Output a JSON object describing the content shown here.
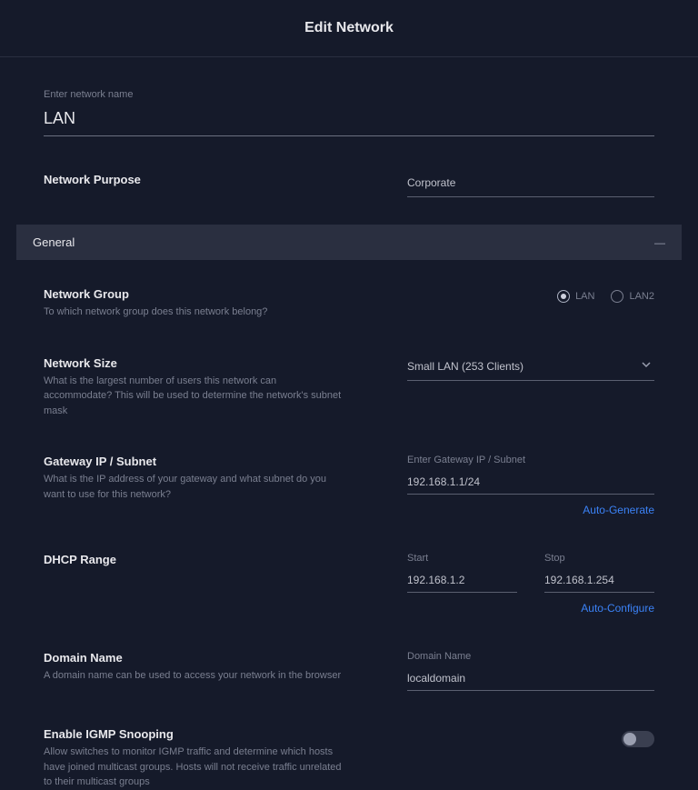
{
  "header": {
    "title": "Edit Network"
  },
  "name_section": {
    "label": "Enter network name",
    "value": "LAN"
  },
  "purpose": {
    "title": "Network Purpose",
    "value": "Corporate"
  },
  "general_section": {
    "title": "General"
  },
  "network_group": {
    "title": "Network Group",
    "desc": "To which network group does this network belong?",
    "options": {
      "lan": "LAN",
      "lan2": "LAN2"
    },
    "selected": "lan"
  },
  "network_size": {
    "title": "Network Size",
    "desc": "What is the largest number of users this network can accommodate? This will be used to determine the network's subnet mask",
    "value": "Small LAN (253 Clients)"
  },
  "gateway": {
    "title": "Gateway IP / Subnet",
    "desc": "What is the IP address of your gateway and what subnet do you want to use for this network?",
    "input_label": "Enter Gateway IP / Subnet",
    "value": "192.168.1.1/24",
    "action": "Auto-Generate"
  },
  "dhcp": {
    "title": "DHCP Range",
    "start_label": "Start",
    "start_value": "192.168.1.2",
    "stop_label": "Stop",
    "stop_value": "192.168.1.254",
    "action": "Auto-Configure"
  },
  "domain": {
    "title": "Domain Name",
    "desc": "A domain name can be used to access your network in the browser",
    "input_label": "Domain Name",
    "value": "localdomain"
  },
  "igmp": {
    "title": "Enable IGMP Snooping",
    "desc": "Allow switches to monitor IGMP traffic and determine which hosts have joined multicast groups. Hosts will not receive traffic unrelated to their multicast groups",
    "enabled": false
  }
}
